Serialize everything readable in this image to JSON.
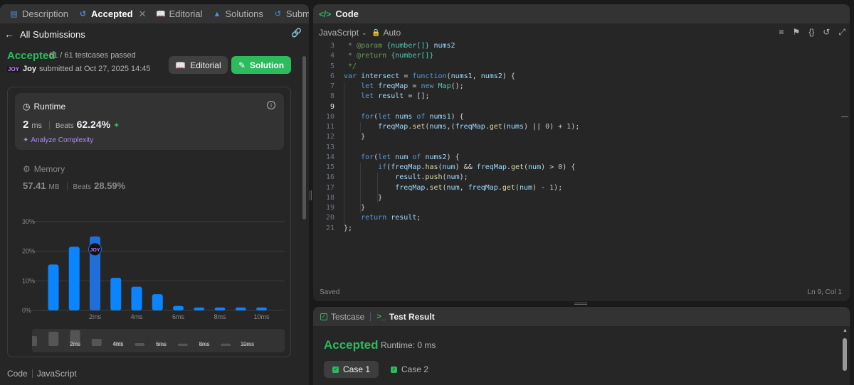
{
  "left": {
    "tabs": [
      {
        "label": "Description"
      },
      {
        "label": "Accepted"
      },
      {
        "label": "Editorial"
      },
      {
        "label": "Solutions"
      },
      {
        "label": "Submissions"
      }
    ],
    "back_label": "All Submissions",
    "result": {
      "status": "Accepted",
      "passed": "61 / 61 testcases passed",
      "avatar_tag": "JOY",
      "user": "Joy",
      "submitted": "submitted at Oct 27, 2025 14:45"
    },
    "buttons": {
      "editorial": "Editorial",
      "solution": "Solution"
    },
    "runtime": {
      "title": "Runtime",
      "value": "2",
      "unit": "ms",
      "beats_label": "Beats",
      "beats": "62.24%",
      "analyze": "Analyze Complexity"
    },
    "memory": {
      "title": "Memory",
      "value": "57.41",
      "unit": "MB",
      "beats_label": "Beats",
      "beats": "28.59%"
    },
    "code_label": "Code",
    "code_lang": "JavaScript"
  },
  "chart_data": {
    "type": "bar",
    "yticks": [
      "30%",
      "20%",
      "10%",
      "0%"
    ],
    "ylim": [
      0,
      30
    ],
    "xticks": [
      "2ms",
      "4ms",
      "6ms",
      "8ms",
      "10ms"
    ],
    "x": [
      1,
      1.5,
      2,
      2.5,
      3,
      3.5,
      4,
      4.5,
      5,
      5.5,
      6
    ],
    "values": [
      15.5,
      21.5,
      25,
      11,
      8,
      5.5,
      1.5,
      1,
      1,
      1,
      1
    ],
    "highlight_index": 2,
    "highlight_label": "JOY",
    "bar_color": "#0a84ff",
    "minimap_values": [
      3.5,
      5,
      5.5,
      2.5,
      1.5,
      1,
      0.8,
      0.8,
      0.8,
      0.8,
      0.8
    ]
  },
  "code": {
    "title": "Code",
    "language": "JavaScript",
    "mode": "Auto",
    "saved": "Saved",
    "cursor": "Ln 9, Col 1",
    "lines": [
      {
        "n": "3",
        "text": " * @param {number[]} nums2"
      },
      {
        "n": "4",
        "text": " * @return {number[]}"
      },
      {
        "n": "5",
        "text": " */"
      },
      {
        "n": "6",
        "text": "var intersect = function(nums1, nums2) {"
      },
      {
        "n": "7",
        "text": "    let freqMap = new Map();"
      },
      {
        "n": "8",
        "text": "    let result = [];"
      },
      {
        "n": "9",
        "text": ""
      },
      {
        "n": "10",
        "text": "    for(let nums of nums1) {"
      },
      {
        "n": "11",
        "text": "        freqMap.set(nums,(freqMap.get(nums) || 0) + 1);"
      },
      {
        "n": "12",
        "text": "    }"
      },
      {
        "n": "13",
        "text": ""
      },
      {
        "n": "14",
        "text": "    for(let num of nums2) {"
      },
      {
        "n": "15",
        "text": "        if(freqMap.has(num) && freqMap.get(num) > 0) {"
      },
      {
        "n": "16",
        "text": "            result.push(num);"
      },
      {
        "n": "17",
        "text": "            freqMap.set(num, freqMap.get(num) - 1);"
      },
      {
        "n": "18",
        "text": "        }"
      },
      {
        "n": "19",
        "text": "    }"
      },
      {
        "n": "20",
        "text": "    return result;"
      },
      {
        "n": "21",
        "text": "};"
      }
    ]
  },
  "test": {
    "tab_testcase": "Testcase",
    "tab_result": "Test Result",
    "status": "Accepted",
    "runtime": "Runtime: 0 ms",
    "cases": [
      "Case 1",
      "Case 2"
    ]
  },
  "colors": {
    "accent_green": "#2cbb5d",
    "bar_blue": "#0a84ff",
    "panel": "#262626",
    "bg": "#1a1a1a"
  }
}
